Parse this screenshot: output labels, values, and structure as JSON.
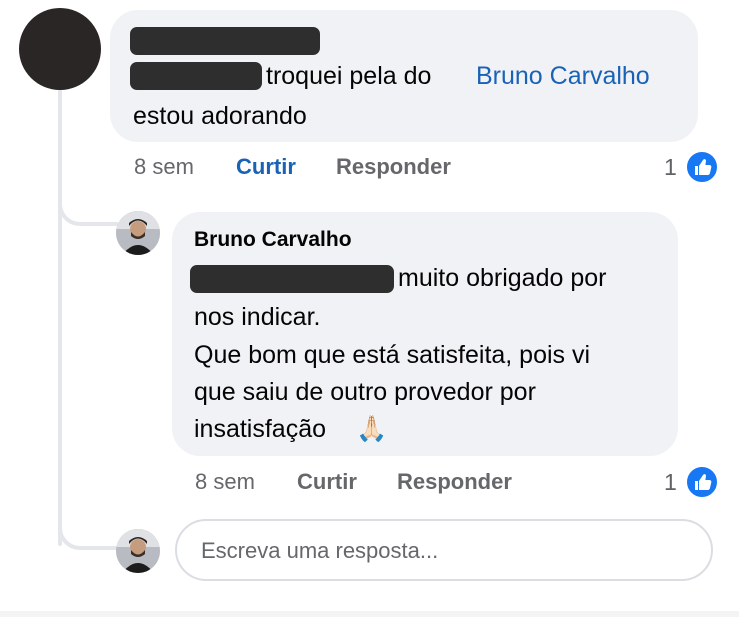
{
  "comment": {
    "text_line1": "troquei pela do",
    "mention": "Bruno Carvalho",
    "text_line2": "estou adorando",
    "time": "8 sem",
    "like_label": "Curtir",
    "reply_label": "Responder",
    "reaction_count": "1"
  },
  "reply": {
    "author": "Bruno Carvalho",
    "line1": "muito obrigado por",
    "line2": "nos indicar.",
    "line3": "Que bom que está satisfeita, pois vi",
    "line4": "que saiu de outro provedor por",
    "line5": "insatisfação",
    "emoji": "🙏🏻",
    "time": "8 sem",
    "like_label": "Curtir",
    "reply_label": "Responder",
    "reaction_count": "1"
  },
  "composer": {
    "placeholder": "Escreva uma resposta..."
  },
  "colors": {
    "mention": "#1a62b5",
    "like_active": "#1a62b5",
    "bubble": "#f0f2f5",
    "like_badge": "#1877f2"
  },
  "icons": {
    "reaction": "like-thumbs-up-icon"
  }
}
